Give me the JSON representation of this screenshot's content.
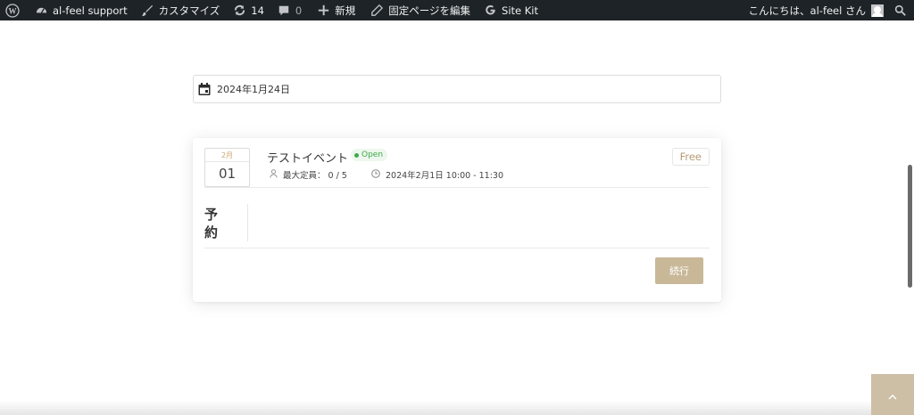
{
  "adminbar": {
    "site_name": "al-feel support",
    "customize": "カスタマイズ",
    "updates_count": "14",
    "comments_count": "0",
    "new": "新規",
    "edit_page": "固定ページを編集",
    "site_kit": "Site Kit",
    "greeting": "こんにちは、al-feel さん"
  },
  "date_picker": {
    "value": "2024年1月24日"
  },
  "event": {
    "month": "2月",
    "day": "01",
    "title": "テストイベント",
    "status": "Open",
    "capacity": "最大定員： 0 / 5",
    "datetime": "2024年2月1日 10:00 - 11:30",
    "price": "Free",
    "booking_label": "予約",
    "continue_label": "続行"
  },
  "colors": {
    "adminbar_bg": "#1d2327",
    "accent_gold": "#c8b898",
    "status_green": "#3daa4a",
    "price_text": "#b89a72"
  },
  "icons": [
    "wordpress-icon",
    "dashboard-icon",
    "brush-icon",
    "updates-icon",
    "comment-icon",
    "plus-icon",
    "pencil-icon",
    "google-icon",
    "search-icon",
    "calendar-icon",
    "person-icon",
    "clock-icon",
    "chevron-up-icon"
  ]
}
